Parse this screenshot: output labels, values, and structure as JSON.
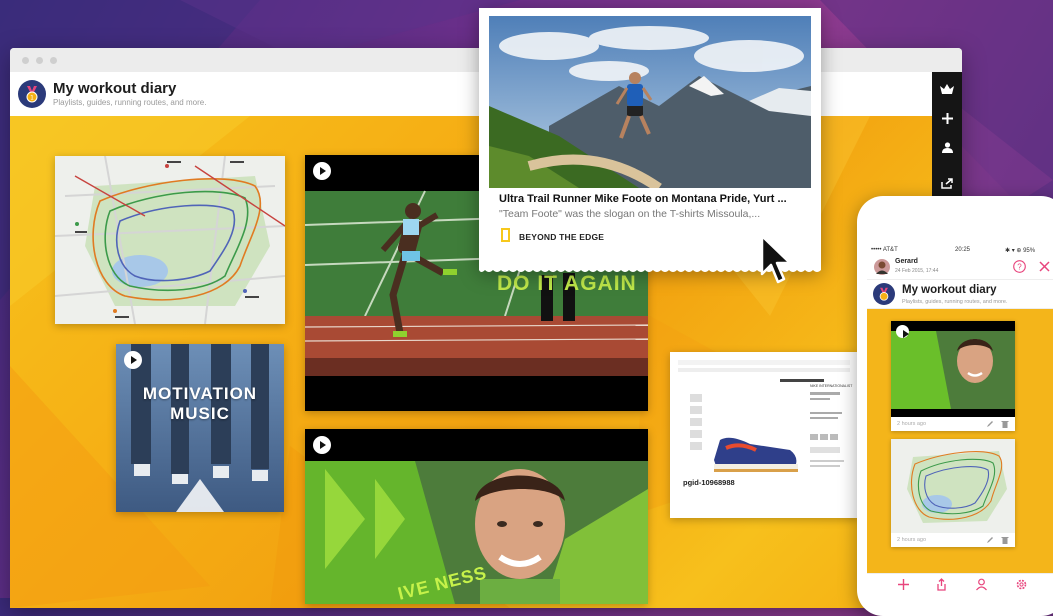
{
  "window": {
    "app_title": "My workout diary",
    "app_subtitle": "Playlists, guides, running routes, and more."
  },
  "toolbar": {
    "icons": [
      "crown-icon",
      "plus-icon",
      "user-icon",
      "share-icon"
    ]
  },
  "cards": {
    "motivation_text_line1": "MOTIVATION",
    "motivation_text_line2": "MUSIC",
    "video_overlay_text": "DO IT AGAIN",
    "video2_overlay_text": "IVE NESS"
  },
  "popup": {
    "title": "Ultra Trail Runner Mike Foote on Montana Pride, Yurt ...",
    "description": "\"Team Foote\" was the slogan on the T-shirts Missoula,...",
    "source": "BEYOND THE EDGE"
  },
  "product": {
    "page_id": "pgid-10968988",
    "product_name": "NIKE INTERNATIONALIST"
  },
  "phone": {
    "status_carrier": "••••• AT&T",
    "status_time": "20:25",
    "status_battery": "✱ ▾ ⊕ 95%",
    "user_name": "Gerard",
    "user_date": "24 Feb 2015, 17:44",
    "app_title": "My workout diary",
    "app_subtitle": "Playlists, guides, running routes, and more.",
    "card1_time": "2 hours ago",
    "card2_time": "2 hours ago",
    "accent_color": "#e8457d"
  },
  "colors": {
    "board_yellow": "#f6b015",
    "background_purple": "#6a2f8a"
  }
}
